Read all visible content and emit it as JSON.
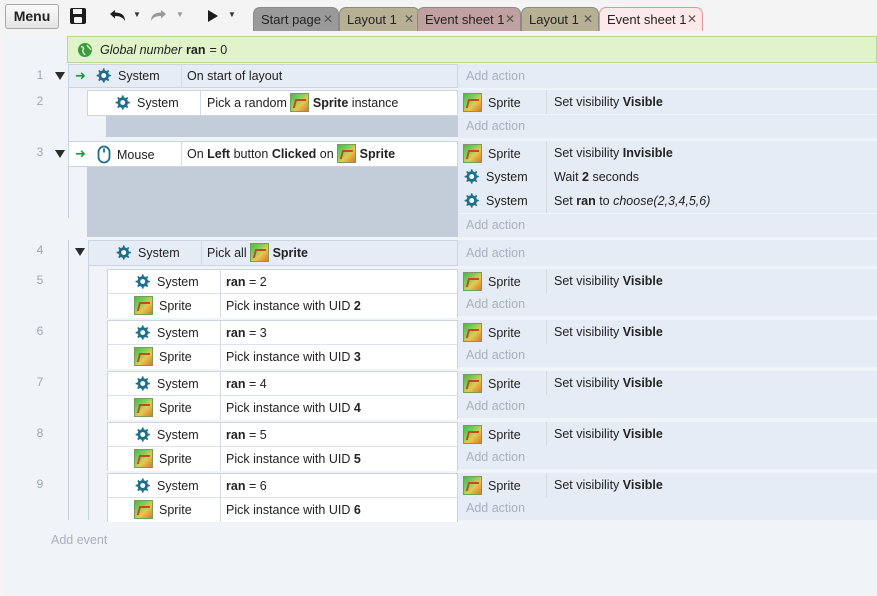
{
  "toolbar": {
    "menu_label": "Menu"
  },
  "tabs": [
    {
      "label": "Start page",
      "kind": "start"
    },
    {
      "label": "Layout 1",
      "kind": "layout"
    },
    {
      "label": "Event sheet 1",
      "kind": "sheet"
    },
    {
      "label": "Layout 1",
      "kind": "layout"
    },
    {
      "label": "Event sheet 1",
      "kind": "active"
    }
  ],
  "global_var": {
    "prefix": "Global number",
    "name": "ran",
    "suffix": "= 0"
  },
  "objects": {
    "system": "System",
    "mouse": "Mouse",
    "sprite": "Sprite"
  },
  "add_action_label": "Add action",
  "add_event_label": "Add event",
  "events": {
    "e1": {
      "num": "1",
      "cond": "On start of layout"
    },
    "e2": {
      "num": "2",
      "cond_pre": "Pick a random",
      "cond_obj": "Sprite",
      "cond_post": "instance",
      "action": {
        "pre": "Set visibility",
        "bold": "Visible"
      }
    },
    "e3": {
      "num": "3",
      "cond_pre": "On",
      "cond_b1": "Left",
      "cond_mid": "button",
      "cond_b2": "Clicked",
      "cond_on": "on",
      "cond_obj": "Sprite",
      "actions": [
        {
          "pre": "Set visibility",
          "bold": "Invisible"
        },
        {
          "pre": "Wait",
          "bold": "2",
          "post": "seconds"
        },
        {
          "pre": "Set",
          "bold": "ran",
          "mid": "to",
          "ital": "choose(2,3,4,5,6)"
        }
      ]
    },
    "e4": {
      "num": "4",
      "cond_pre": "Pick all",
      "cond_obj": "Sprite"
    },
    "subs": [
      {
        "num": "5",
        "var": "ran",
        "cmp": "= 2",
        "uid_pre": "Pick instance with UID",
        "uid": "2",
        "act_pre": "Set visibility",
        "act_bold": "Visible"
      },
      {
        "num": "6",
        "var": "ran",
        "cmp": "= 3",
        "uid_pre": "Pick instance with UID",
        "uid": "3",
        "act_pre": "Set visibility",
        "act_bold": "Visible"
      },
      {
        "num": "7",
        "var": "ran",
        "cmp": "= 4",
        "uid_pre": "Pick instance with UID",
        "uid": "4",
        "act_pre": "Set visibility",
        "act_bold": "Visible"
      },
      {
        "num": "8",
        "var": "ran",
        "cmp": "= 5",
        "uid_pre": "Pick instance with UID",
        "uid": "5",
        "act_pre": "Set visibility",
        "act_bold": "Visible"
      },
      {
        "num": "9",
        "var": "ran",
        "cmp": "= 6",
        "uid_pre": "Pick instance with UID",
        "uid": "6",
        "act_pre": "Set visibility",
        "act_bold": "Visible"
      }
    ]
  },
  "colors": {
    "accent_tab": "#fde8ea",
    "global_var_bg": "#e1f3c8",
    "gear": "#1f6f8b"
  },
  "icons": [
    "save-icon",
    "undo-icon",
    "redo-icon",
    "play-icon",
    "gear-icon",
    "mouse-icon",
    "sprite-icon",
    "globe-icon",
    "arrow-right-icon",
    "close-icon"
  ]
}
